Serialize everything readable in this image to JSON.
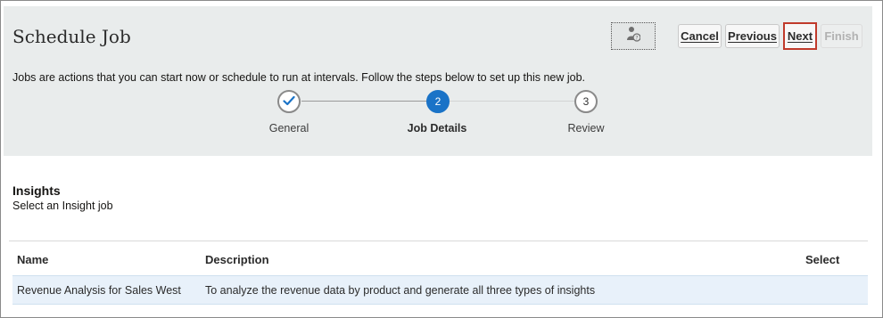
{
  "header": {
    "title": "Schedule Job",
    "intro": "Jobs are actions that you can start now or schedule to run at intervals. Follow the steps below to set up this new job.",
    "help_icon": "user-help-icon"
  },
  "toolbar": {
    "cancel_label": "Cancel",
    "previous_label": "Previous",
    "next_label": "Next",
    "finish_label": "Finish"
  },
  "train": {
    "steps": [
      {
        "number": "1",
        "label": "General",
        "state": "completed",
        "icon": "checkmark-icon"
      },
      {
        "number": "2",
        "label": "Job Details",
        "state": "current"
      },
      {
        "number": "3",
        "label": "Review",
        "state": "pending"
      }
    ],
    "accent_color": "#1a73c7"
  },
  "section": {
    "title": "Insights",
    "subtitle": "Select an Insight job"
  },
  "table": {
    "columns": [
      "Name",
      "Description",
      "Select"
    ],
    "rows": [
      {
        "name": "Revenue Analysis for Sales West",
        "description": "To analyze the revenue data by product and generate all three types of insights",
        "select": ""
      }
    ],
    "selected_row_color": "#e8f1fa"
  }
}
